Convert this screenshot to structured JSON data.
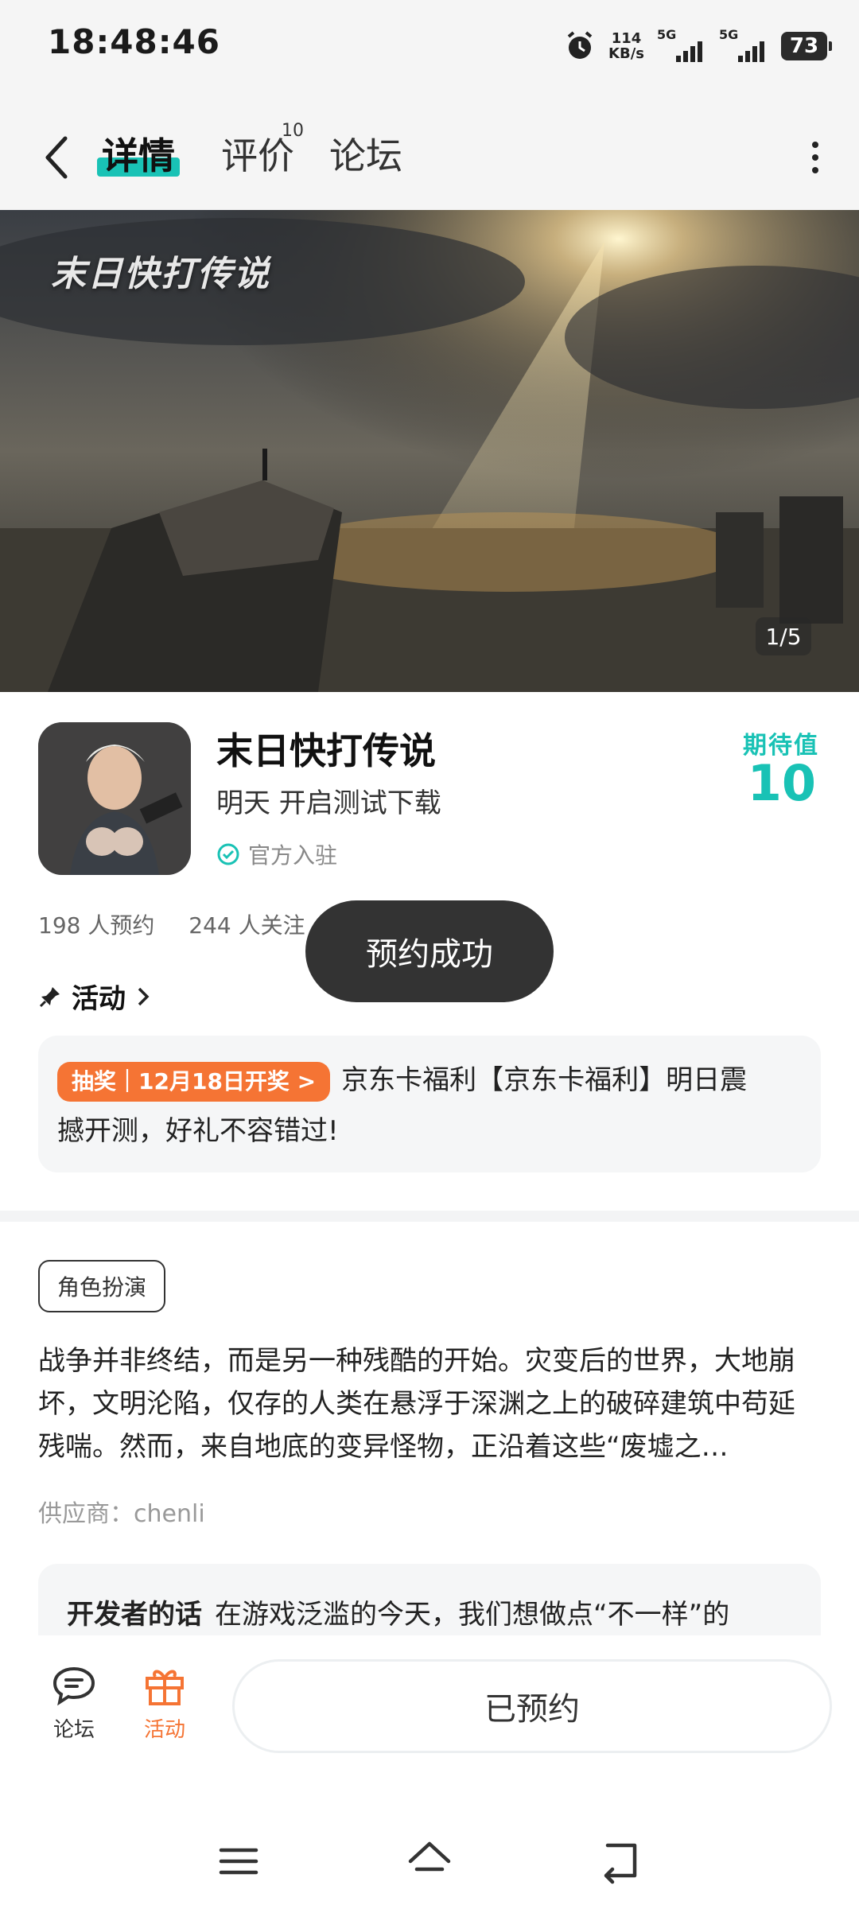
{
  "status": {
    "time": "18:48:46",
    "speed_value": "114",
    "speed_unit": "KB/s",
    "signal1": "5G",
    "signal2": "5G",
    "battery": "73"
  },
  "nav": {
    "tabs": [
      {
        "label": "详情"
      },
      {
        "label": "评价",
        "badge": "10"
      },
      {
        "label": "论坛"
      }
    ],
    "accent": "#19c2b5"
  },
  "banner": {
    "logo_text": "末日快打传说",
    "counter": "1/5"
  },
  "game": {
    "title": "末日快打传说",
    "subtitle": "明天 开启测试下载",
    "official": "官方入驻",
    "expect_label": "期待值",
    "expect_value": "10"
  },
  "stats": {
    "reservations": "198 人预约",
    "followers": "244 人关注"
  },
  "toast": "预约成功",
  "activity": {
    "header": "活动",
    "tag": "抽奖｜12月18日开奖 >",
    "text": "京东卡福利【京东卡福利】明日震撼开测，好礼不容错过!"
  },
  "info": {
    "genre": "角色扮演",
    "description": "战争并非终结，而是另一种残酷的开始。灾变后的世界，大地崩坏，文明沦陷，仅存的人类在悬浮于深渊之上的破碎建筑中苟延残喘。然而，来自地底的变异怪物，正沿着这些“废墟之…",
    "supplier": "供应商：chenli",
    "dev_title": "开发者的话",
    "dev_text": "在游戏泛滥的今天，我们想做点“不一样”的"
  },
  "bottombar": {
    "forum": "论坛",
    "activity": "活动",
    "reserved": "已预约",
    "activity_color": "#f57434"
  }
}
